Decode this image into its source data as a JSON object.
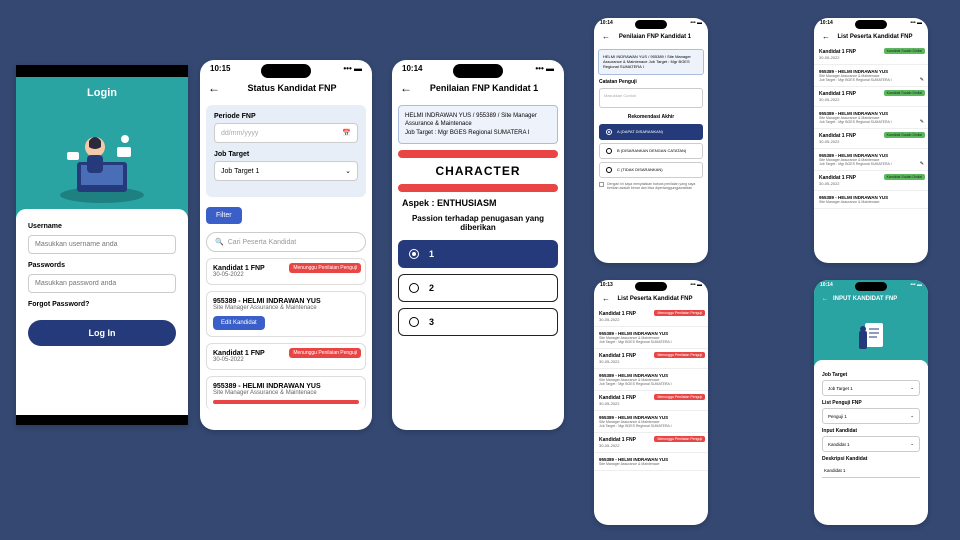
{
  "time1": "10:15",
  "time2": "10:14",
  "time3": "10:14",
  "time4": "10:13",
  "login": {
    "title": "Login",
    "user_label": "Username",
    "user_ph": "Masukkan username anda",
    "pass_label": "Passwords",
    "pass_ph": "Masukkan password anda",
    "forgot": "Forgot Password?",
    "btn": "Log In"
  },
  "p2": {
    "title": "Status Kandidat FNP",
    "periode_label": "Periode FNP",
    "periode_ph": "dd/mm/yyyy",
    "job_label": "Job Target",
    "job_val": "Job Target 1",
    "filter": "Filter",
    "search_ph": "Cari Peserta Kandidat",
    "k1_name": "Kandidat 1 FNP",
    "k1_date": "30-05-2022",
    "badge_wait": "Menunggu Penilaian Penguji",
    "emp": "955389 - HELMI INDRAWAN YUS",
    "role": "Site Manager Assurance & Maintenace",
    "edit": "Edit Kandidat"
  },
  "p3": {
    "title": "Penilaian FNP Kandidat 1",
    "info1": "HELMI INDRAWAN YUS / 955389 / Site Manager Assurance & Maintenace",
    "info2": "Job Target : Mgr BGES Regional SUMATERA I",
    "character": "CHARACTER",
    "aspek": "Aspek : ENTHUSIASM",
    "passion": "Passion terhadap penugasan yang diberikan",
    "o1": "1",
    "o2": "2",
    "o3": "3"
  },
  "p4": {
    "title": "Penilaian FNP Kandidat 1",
    "info": "HELMI INDRAWAN YUS / 955389 / Site Manager Assurance & Maintenace\nJob Target : Mgr BGES Regional SUMATERA I",
    "cat_label": "Catatan Penguji",
    "cat_ph": "Masukkan Contoh",
    "rekom": "Rekomendasi Akhir",
    "ra": "A (DAPAT DISARANKAN)",
    "rb": "B (DISARANKAN DENGAN CATATAN)",
    "rc": "C (TIDAK DISARANKAN)",
    "disc": "Dengan ini saya menyatakan bahwa penilaian yang saya berikan adalah benar dan bisa dipertanggungjawabkan"
  },
  "p5": {
    "title": "List Peserta Kandidat FNP",
    "badge": "Menunggu Penilaian Penguji",
    "k": "Kandidat 1 FNP",
    "d": "30-05-2022",
    "emp": "955389 - HELMI INDRAWAN YUS",
    "role": "Site Manager Assurance & Maintenace",
    "tgt": "Job Target : Mgr BGES Regional SUMATERA I"
  },
  "p6": {
    "title": "List Peserta Kandidat FNP",
    "badge": "Kandidat Sudah Dinilai"
  },
  "p7": {
    "title": "INPUT KANDIDAT FNP",
    "job_label": "Job Target",
    "job_val": "Job Target 1",
    "list_label": "List Penguji FNP",
    "list_val": "Penguji 1",
    "input_label": "Input Kandidat",
    "input_val": "Kandidat 1",
    "desc_label": "Deskripsi Kandidat",
    "desc_val": "Kandidat 1"
  }
}
